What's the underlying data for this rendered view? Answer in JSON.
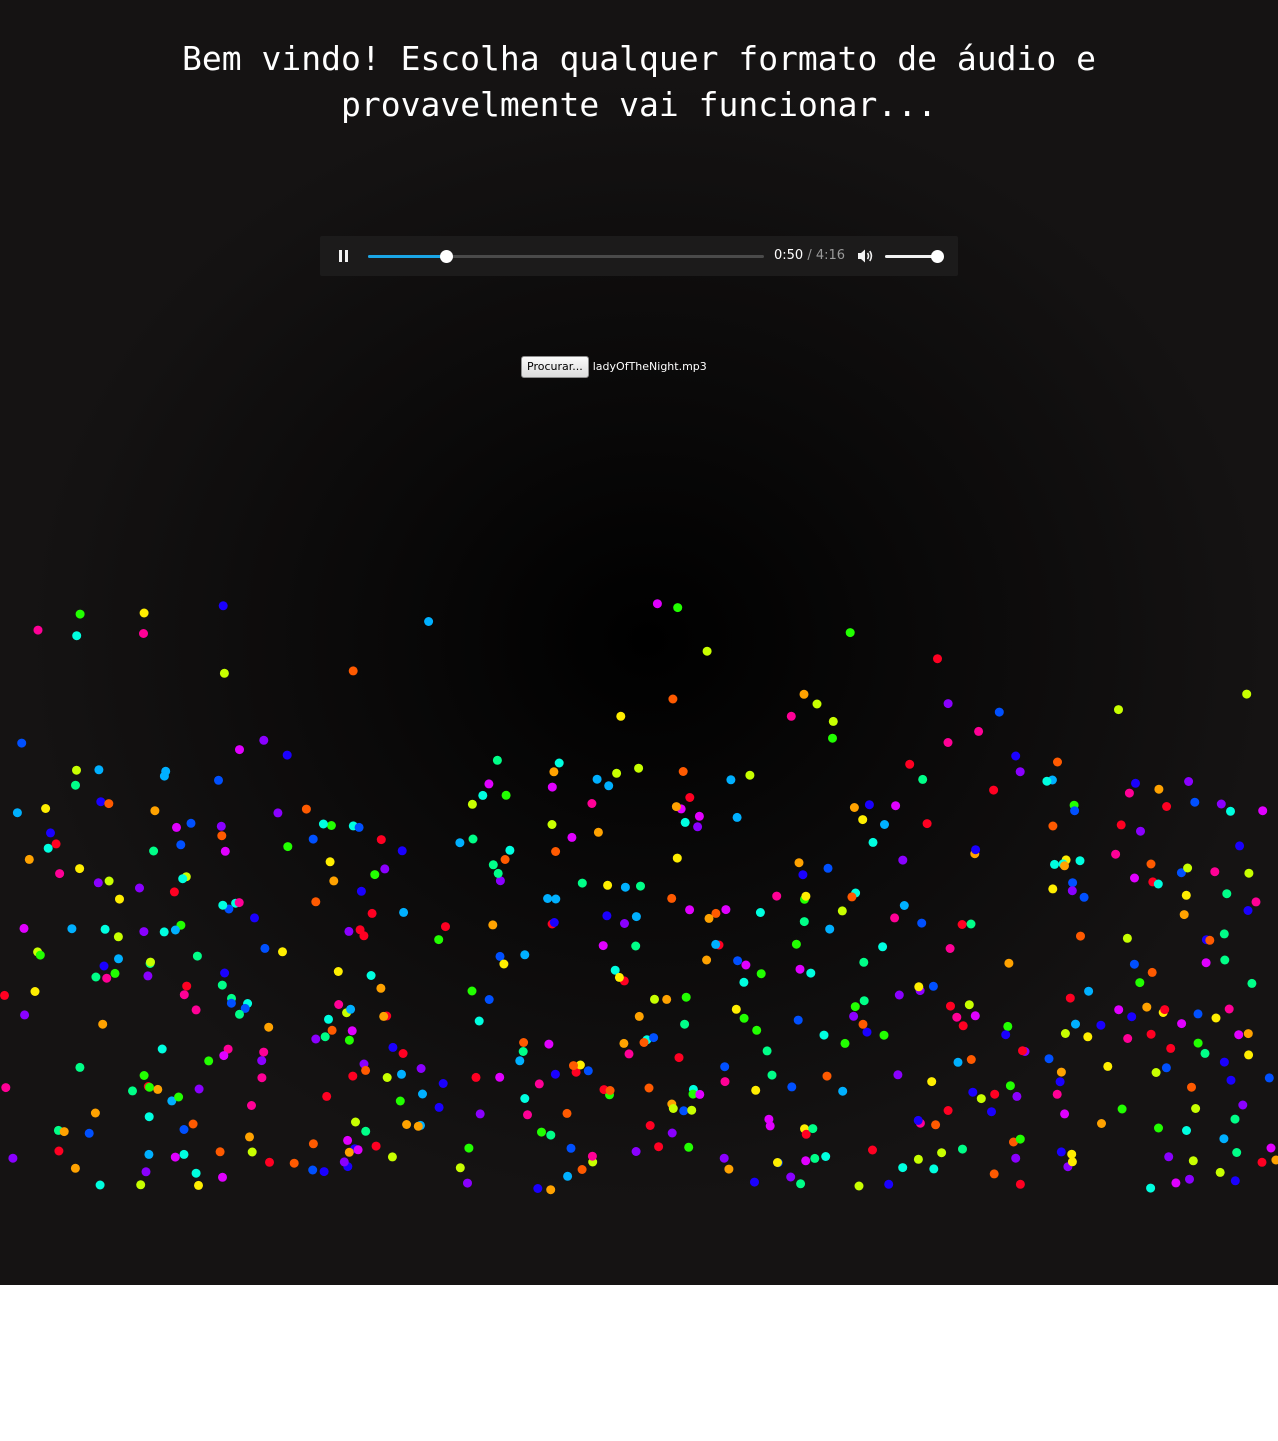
{
  "heading": "Bem vindo! Escolha qualquer formato de áudio e provavelmente vai funcionar...",
  "player": {
    "state": "playing",
    "current_time": "0:50",
    "separator": " / ",
    "duration": "4:16",
    "progress_fraction": 0.198,
    "volume_fraction": 1.0,
    "accent_color": "#1aa6e6"
  },
  "file_input": {
    "button_label": "Procurar...",
    "file_name": "ladyOfTheNight.mp3"
  },
  "visualizer": {
    "particle_colors": [
      "#ff0022",
      "#ff5a00",
      "#ffa200",
      "#ffee00",
      "#c8ff00",
      "#22ff00",
      "#00ff88",
      "#00ffe0",
      "#00b0ff",
      "#0050ff",
      "#1a00ff",
      "#8a00ff",
      "#e000ff",
      "#ff0096"
    ]
  }
}
